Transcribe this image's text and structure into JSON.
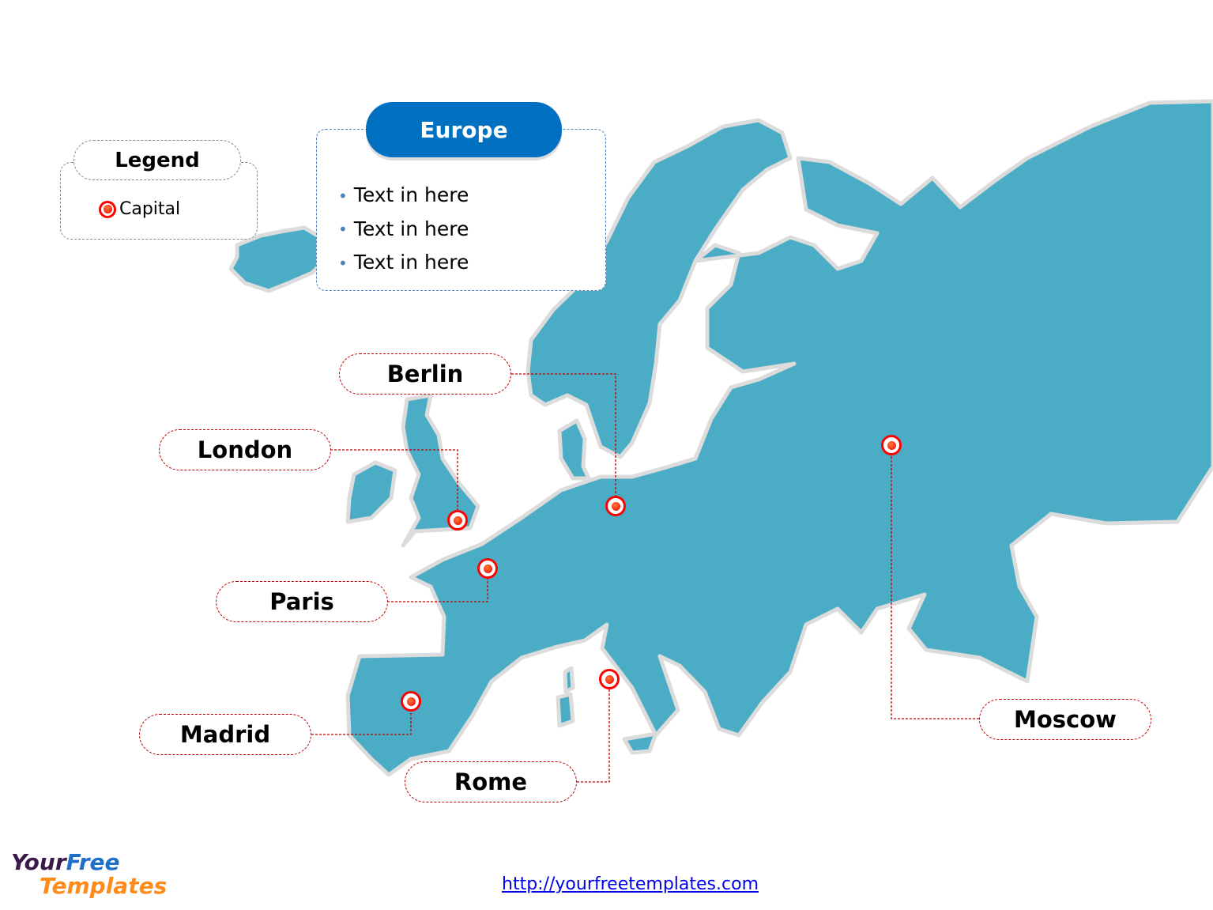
{
  "legend": {
    "title": "Legend",
    "items": [
      {
        "label": "Capital",
        "icon": "capital-marker-icon"
      }
    ]
  },
  "info_box": {
    "title": "Europe",
    "bullets": [
      "Text in here",
      "Text in here",
      "Text in here"
    ]
  },
  "cities": [
    {
      "name": "Berlin"
    },
    {
      "name": "London"
    },
    {
      "name": "Paris"
    },
    {
      "name": "Madrid"
    },
    {
      "name": "Rome"
    },
    {
      "name": "Moscow"
    }
  ],
  "colors": {
    "land": "#4bacc6",
    "header": "#0070c0",
    "capital": "#ff0000",
    "leader": "#c00000"
  },
  "footer": {
    "link": "http://yourfreetemplates.com"
  },
  "logo": {
    "line1a": "Your",
    "line1b": "Free",
    "line2": "Templates"
  }
}
